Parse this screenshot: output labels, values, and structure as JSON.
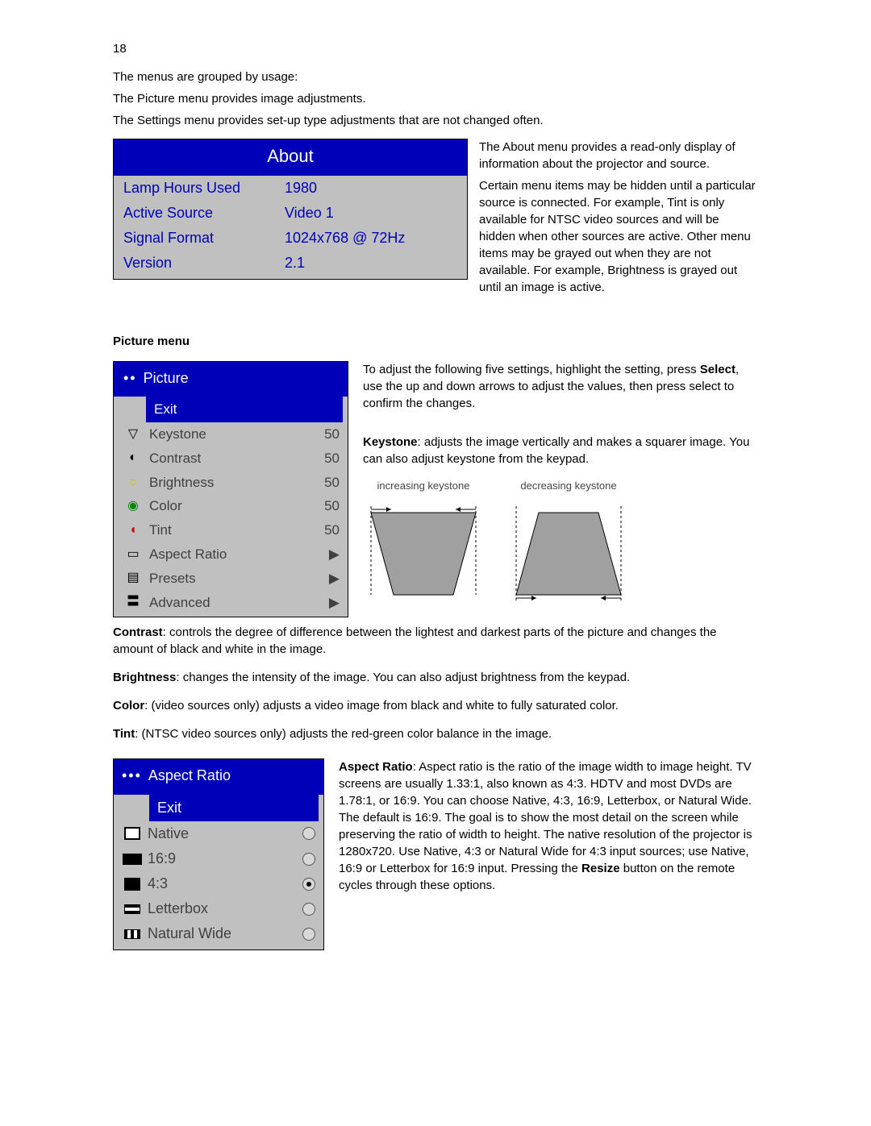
{
  "page_number": "18",
  "intro": {
    "line1": "The menus are grouped by usage:",
    "line2": "The Picture menu provides image adjustments.",
    "line3": "The Settings menu provides set-up type adjustments that are not changed often."
  },
  "about_menu": {
    "title": "About",
    "rows": [
      {
        "label": "Lamp Hours Used",
        "value": "1980"
      },
      {
        "label": "Active Source",
        "value": "Video 1"
      },
      {
        "label": "Signal Format",
        "value": "1024x768 @ 72Hz"
      },
      {
        "label": "Version",
        "value": "2.1"
      }
    ]
  },
  "about_text": "The About menu provides a read-only display of information about the projector and source.",
  "hidden_text": "Certain menu items may be hidden until a particular source is connected. For example, Tint is only available for NTSC video sources and will be hidden when other sources are active. Other menu items may be grayed out when they are not available. For example, Brightness is grayed out until an image is active.",
  "picture_heading": "Picture menu",
  "picture_menu": {
    "title": "Picture",
    "exit": "Exit",
    "items": [
      {
        "icon": "▽",
        "label": "Keystone",
        "value": "50"
      },
      {
        "icon": "◐",
        "label": "Contrast",
        "value": "50"
      },
      {
        "icon": "☼",
        "label": "Brightness",
        "value": "50"
      },
      {
        "icon": "◉",
        "label": "Color",
        "value": "50"
      },
      {
        "icon": "◖",
        "label": "Tint",
        "value": "50"
      },
      {
        "icon": "▭",
        "label": "Aspect Ratio",
        "value": "▶"
      },
      {
        "icon": "▤",
        "label": "Presets",
        "value": "▶"
      },
      {
        "icon": "〓",
        "label": "Advanced",
        "value": "▶"
      }
    ]
  },
  "picture_intro_1": "To adjust the following five settings, highlight the setting, press ",
  "picture_intro_bold": "Select",
  "picture_intro_2": ", use the up and down arrows to adjust the values, then press select to confirm the changes.",
  "keystone_label": "Keystone",
  "keystone_text": ": adjusts the image vertically and makes a squarer image. You can also adjust keystone from the keypad.",
  "kd_inc": "increasing keystone",
  "kd_dec": "decreasing keystone",
  "contrast_label": "Contrast",
  "contrast_text": ": controls the degree of difference between the lightest and darkest parts of the picture and changes the amount of black and white in the image.",
  "brightness_label": "Brightness",
  "brightness_text": ": changes the intensity of the image. You can also adjust brightness from the keypad.",
  "color_label": "Color",
  "color_text": ": (video sources only) adjusts a video image from black and white to fully saturated color.",
  "tint_label": "Tint",
  "tint_text": ": (NTSC video sources only) adjusts the red-green color balance in the image.",
  "aspect_menu": {
    "title": "Aspect Ratio",
    "exit": "Exit",
    "items": [
      {
        "label": "Native",
        "selected": false
      },
      {
        "label": "16:9",
        "selected": false
      },
      {
        "label": "4:3",
        "selected": true
      },
      {
        "label": "Letterbox",
        "selected": false
      },
      {
        "label": "Natural Wide",
        "selected": false
      }
    ]
  },
  "aspect_label": "Aspect Ratio",
  "aspect_text_1": ": Aspect ratio is the ratio of the image width to image height. TV screens are usually 1.33:1, also known as 4:3. HDTV and most DVDs are 1.78:1, or 16:9. You can choose Native, 4:3, 16:9, Letterbox, or Natural Wide. The default is 16:9. The goal is to show the most detail on the screen while preserving the ratio of width to height. The native resolution of the projector is 1280x720. Use Native, 4:3 or Natural Wide for 4:3 input sources; use Native, 16:9 or Letterbox for 16:9 input. Pressing the ",
  "aspect_bold": "Resize",
  "aspect_text_2": " button on the remote cycles through these options."
}
